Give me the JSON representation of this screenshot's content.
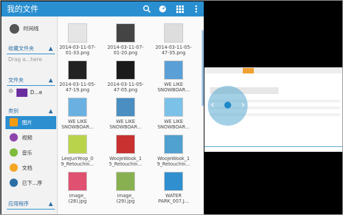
{
  "app": {
    "title": "我的文件"
  },
  "sidebar": {
    "recent": "时间线",
    "favorites_header": "收藏文件夹",
    "drag_hint": "Drag a...here",
    "folders_header": "文件夹",
    "folder_item": "D...e",
    "categories_header": "类别",
    "categories": [
      "图片",
      "视频",
      "音乐",
      "文档",
      "已下...序"
    ],
    "apps_header": "应用程序"
  },
  "files": [
    {
      "name": "2014-03-11-07-\n01-33.png"
    },
    {
      "name": "2014-03-11-07-\n01-20.png"
    },
    {
      "name": "2014-03-11-05-\n47-35.png"
    },
    {
      "name": "2014-03-11-05-\n47-19.png"
    },
    {
      "name": "2014-03-11-05-\n47-05.png"
    },
    {
      "name": "WE LIKE\nSNOWBOAR..."
    },
    {
      "name": "WE LIKE\nSNOWBOAR..."
    },
    {
      "name": "WE LIKE\nSNOWBOAR..."
    },
    {
      "name": "WE LIKE\nSNOWBOAR..."
    },
    {
      "name": "LeeJunYeop_0\n9_Retouchin..."
    },
    {
      "name": "WooJeWook_1\n5_Retouchin..."
    },
    {
      "name": "WooJeWook_1\n9_Retouchin..."
    },
    {
      "name": "image_\n(28).jpg"
    },
    {
      "name": "image_\n(29).jpg"
    },
    {
      "name": "WATER\nPARK_007.J..."
    }
  ],
  "colors": {
    "accent": "#2a8fd0",
    "header": "#2b6fa6"
  }
}
